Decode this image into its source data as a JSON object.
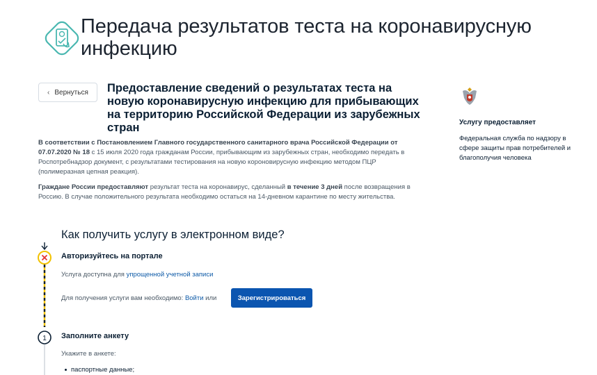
{
  "header": {
    "title": "Передача результатов теста на коронавирусную инфекцию"
  },
  "nav": {
    "back_label": "Вернуться"
  },
  "service": {
    "heading": "Предоставление сведений о результатах теста на новую коронавирусную инфекцию для прибывающих на территорию Российской Федерации из зарубежных стран"
  },
  "provider": {
    "label": "Услугу предоставляет",
    "name": "Федеральная служба по надзору в сфере защиты прав потребителей и благополучия человека"
  },
  "intro": {
    "p1_bold": "В соответствии с Постановлением Главного государственного санитарного врача Российской Федерации от 07.07.2020 № 18",
    "p1_rest": " с 15 июля 2020 года гражданам России, прибывающим из зарубежных стран, необходимо передать в Роспотребнадзор документ, с результатами тестирования на новую короновирусную инфекцию методом ПЦР (полимеразная цепная реакция).",
    "p2_bold1": "Граждане России предоставляют",
    "p2_mid": " результат теста на коронавирус, сделанный ",
    "p2_bold2": "в течение 3 дней",
    "p2_rest": " после возвращения в Россию. В случае положительного результата необходимо остаться на 14-дневном карантине по месту жительства."
  },
  "steps_section": {
    "title": "Как получить услугу в электронном виде?",
    "step1": {
      "title": "Авторизуйтесь на портале",
      "available_prefix": "Услуга доступна для ",
      "available_link": "упрощенной учетной записи",
      "need_prefix": "Для получения услуги вам необходимо: ",
      "login_link": "Войти",
      "or_text": " или",
      "register_label": "Зарегистрироваться"
    },
    "step2": {
      "number": "1",
      "title": "Заполните анкету",
      "indicate": "Укажите в анкете:",
      "items": [
        "паспортные данные;"
      ]
    }
  },
  "colors": {
    "accent": "#0b55b0",
    "link": "#0d5aa7",
    "error": "#e4342f",
    "timeline_yellow": "#f2c200",
    "logo_teal": "#49b7b0"
  }
}
